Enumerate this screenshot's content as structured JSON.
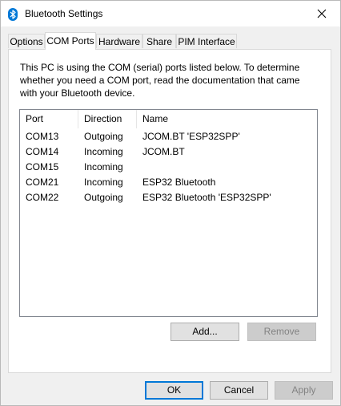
{
  "window": {
    "title": "Bluetooth Settings",
    "icon": "bluetooth-icon",
    "close_icon": "close-icon"
  },
  "tabs": [
    {
      "label": "Options",
      "active": false
    },
    {
      "label": "COM Ports",
      "active": true
    },
    {
      "label": "Hardware",
      "active": false
    },
    {
      "label": "Share",
      "active": false
    },
    {
      "label": "PIM Interface",
      "active": false
    }
  ],
  "com_ports": {
    "description": "This PC is using the COM (serial) ports listed below. To determine\nwhether you need a COM port, read the documentation that came\nwith your Bluetooth device.",
    "columns": [
      "Port",
      "Direction",
      "Name"
    ],
    "rows": [
      {
        "port": "COM13",
        "direction": "Outgoing",
        "name": "JCOM.BT 'ESP32SPP'"
      },
      {
        "port": "COM14",
        "direction": "Incoming",
        "name": "JCOM.BT"
      },
      {
        "port": "COM15",
        "direction": "Incoming",
        "name": ""
      },
      {
        "port": "COM21",
        "direction": "Incoming",
        "name": "ESP32 Bluetooth"
      },
      {
        "port": "COM22",
        "direction": "Outgoing",
        "name": "ESP32 Bluetooth 'ESP32SPP'"
      }
    ],
    "add_label": "Add...",
    "remove_label": "Remove"
  },
  "footer": {
    "ok_label": "OK",
    "cancel_label": "Cancel",
    "apply_label": "Apply"
  },
  "colors": {
    "bluetooth": "#0078d7",
    "default_button_border": "#0078d7",
    "disabled_text": "#838383"
  }
}
